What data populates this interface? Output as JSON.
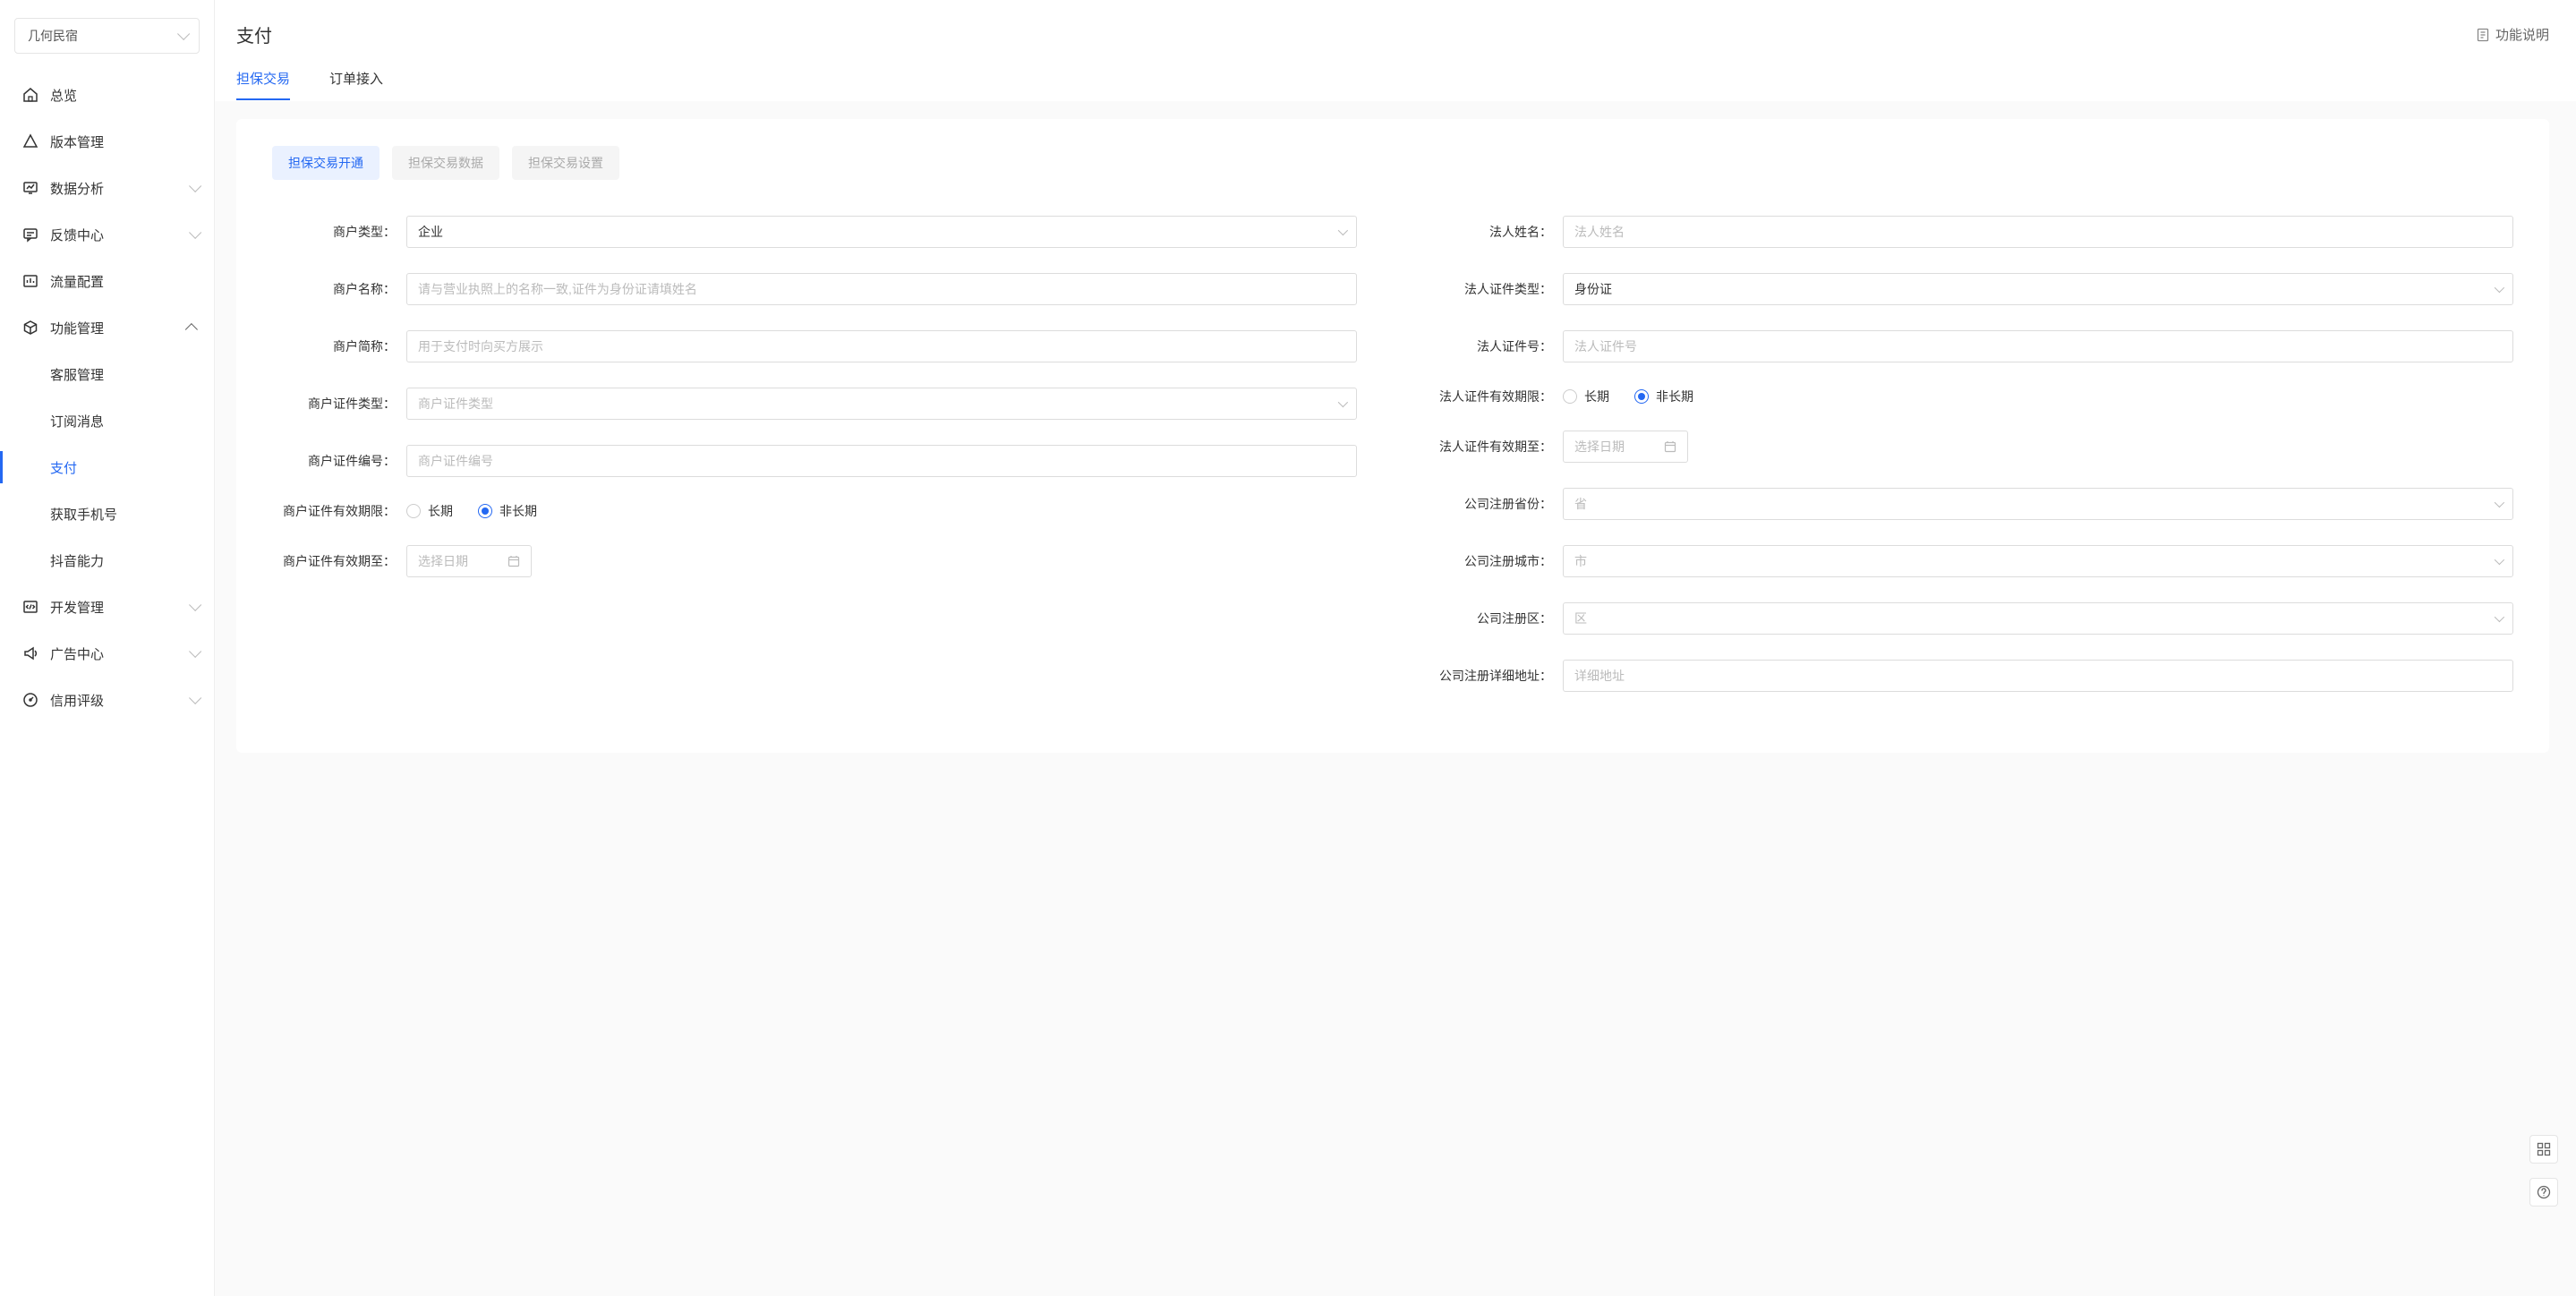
{
  "appSelect": {
    "label": "几何民宿"
  },
  "sidebar": {
    "items": [
      {
        "icon": "home",
        "label": "总览",
        "expand": "none"
      },
      {
        "icon": "version",
        "label": "版本管理",
        "expand": "none"
      },
      {
        "icon": "chart",
        "label": "数据分析",
        "expand": "down"
      },
      {
        "icon": "feedback",
        "label": "反馈中心",
        "expand": "down"
      },
      {
        "icon": "traffic",
        "label": "流量配置",
        "expand": "none"
      },
      {
        "icon": "cube",
        "label": "功能管理",
        "expand": "up",
        "children": [
          {
            "label": "客服管理"
          },
          {
            "label": "订阅消息"
          },
          {
            "label": "支付",
            "active": true
          },
          {
            "label": "获取手机号"
          },
          {
            "label": "抖音能力"
          }
        ]
      },
      {
        "icon": "code",
        "label": "开发管理",
        "expand": "down"
      },
      {
        "icon": "megaphone",
        "label": "广告中心",
        "expand": "down"
      },
      {
        "icon": "gauge",
        "label": "信用评级",
        "expand": "down"
      }
    ]
  },
  "header": {
    "title": "支付",
    "help": "功能说明",
    "tabs": [
      {
        "label": "担保交易",
        "active": true
      },
      {
        "label": "订单接入"
      }
    ]
  },
  "segTabs": [
    {
      "label": "担保交易开通",
      "active": true
    },
    {
      "label": "担保交易数据"
    },
    {
      "label": "担保交易设置"
    }
  ],
  "form": {
    "left": {
      "merchantType": {
        "label": "商户类型：",
        "value": "企业"
      },
      "merchantName": {
        "label": "商户名称：",
        "placeholder": "请与营业执照上的名称一致,证件为身份证请填姓名"
      },
      "merchantShort": {
        "label": "商户简称：",
        "placeholder": "用于支付时向买方展示"
      },
      "merchantCertType": {
        "label": "商户证件类型：",
        "placeholder": "商户证件类型"
      },
      "merchantCertNo": {
        "label": "商户证件编号：",
        "placeholder": "商户证件编号"
      },
      "merchantCertValid": {
        "label": "商户证件有效期限：",
        "opt1": "长期",
        "opt2": "非长期",
        "selected": "opt2"
      },
      "merchantCertExpiry": {
        "label": "商户证件有效期至：",
        "placeholder": "选择日期"
      }
    },
    "right": {
      "legalName": {
        "label": "法人姓名：",
        "placeholder": "法人姓名"
      },
      "legalCertType": {
        "label": "法人证件类型：",
        "value": "身份证"
      },
      "legalCertNo": {
        "label": "法人证件号：",
        "placeholder": "法人证件号"
      },
      "legalCertValid": {
        "label": "法人证件有效期限：",
        "opt1": "长期",
        "opt2": "非长期",
        "selected": "opt2"
      },
      "legalCertExpiry": {
        "label": "法人证件有效期至：",
        "placeholder": "选择日期"
      },
      "province": {
        "label": "公司注册省份：",
        "placeholder": "省"
      },
      "city": {
        "label": "公司注册城市：",
        "placeholder": "市"
      },
      "district": {
        "label": "公司注册区：",
        "placeholder": "区"
      },
      "address": {
        "label": "公司注册详细地址：",
        "placeholder": "详细地址"
      }
    }
  }
}
